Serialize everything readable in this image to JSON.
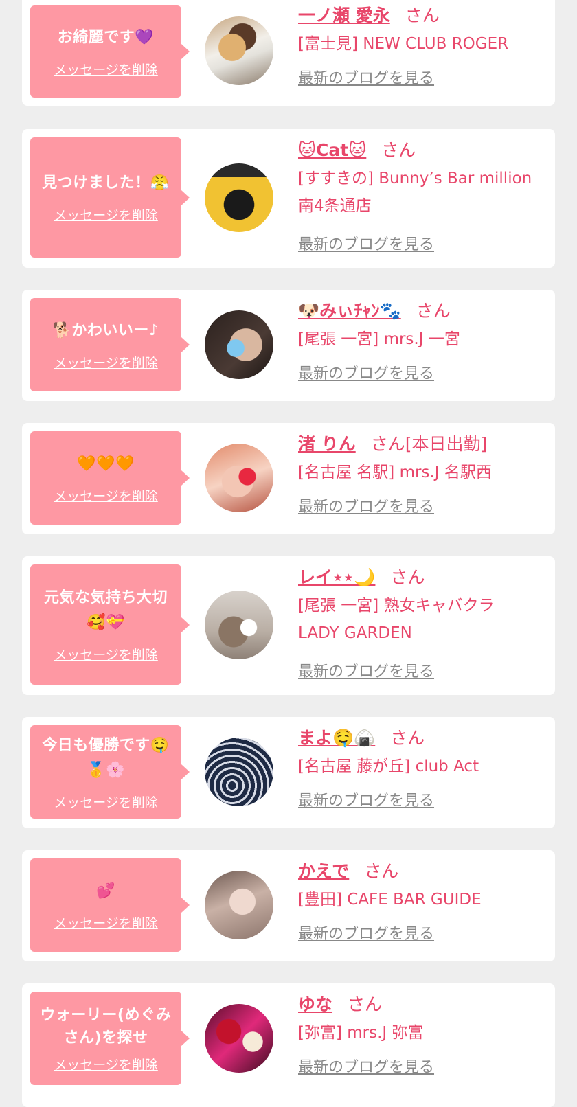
{
  "accent_color": "#e8466a",
  "bubble_color": "#fe98a3",
  "items": [
    {
      "message": "お綺麗です💜",
      "delete_label": "メッセージを削除",
      "name": "一ノ瀬 愛永",
      "suffix": "さん",
      "shop_lines": [
        "[富士見] NEW CLUB ROGER"
      ],
      "blog_label": "最新のブログを見る"
    },
    {
      "message": "見つけました！😤",
      "delete_label": "メッセージを削除",
      "name": "🐱Cat🐱",
      "suffix": "さん",
      "shop_lines": [
        "[すすきの] Bunny’s Bar million",
        "南4条通店"
      ],
      "blog_label": "最新のブログを見る"
    },
    {
      "message": "🐕かわいいー♪",
      "delete_label": "メッセージを削除",
      "name": "🐶みぃﾁｬﾝ🐾",
      "suffix": "さん",
      "shop_lines": [
        "[尾張 一宮] mrs.J 一宮"
      ],
      "blog_label": "最新のブログを見る"
    },
    {
      "message": "🧡🧡🧡",
      "delete_label": "メッセージを削除",
      "name": "渚 りん",
      "suffix": "さん[本日出勤]",
      "shop_lines": [
        "[名古屋 名駅] mrs.J 名駅西"
      ],
      "blog_label": "最新のブログを見る"
    },
    {
      "message": "元気な気持ち大切🥰💝",
      "delete_label": "メッセージを削除",
      "name": "レイ⋆⋆🌙",
      "suffix": "さん",
      "shop_lines": [
        "[尾張 一宮] 熟女キャバクラ",
        "LADY GARDEN"
      ],
      "blog_label": "最新のブログを見る"
    },
    {
      "message": "今日も優勝です🤤🥇🌸",
      "delete_label": "メッセージを削除",
      "name": "まよ🤤🍙",
      "suffix": "さん",
      "shop_lines": [
        "[名古屋 藤が丘] club Act"
      ],
      "blog_label": "最新のブログを見る"
    },
    {
      "message": "💕",
      "delete_label": "メッセージを削除",
      "name": "かえで",
      "suffix": "さん",
      "shop_lines": [
        "[豊田] CAFE BAR GUIDE"
      ],
      "blog_label": "最新のブログを見る"
    },
    {
      "message": "ウォーリー(めぐみさん)を探せ",
      "delete_label": "メッセージを削除",
      "name": "ゆな",
      "suffix": "さん",
      "shop_lines": [
        "[弥富] mrs.J 弥富"
      ],
      "blog_label": "最新のブログを見る"
    }
  ]
}
